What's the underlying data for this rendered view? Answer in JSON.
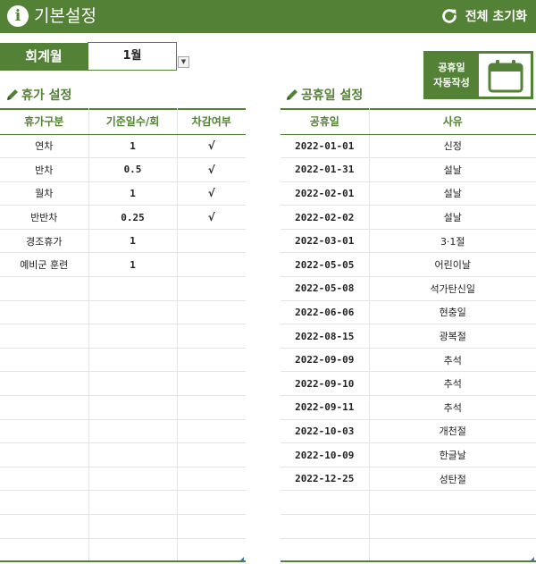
{
  "header": {
    "title": "기본설정",
    "reset_label": "전체 초기화",
    "info_icon": "info-icon",
    "reset_icon": "refresh-icon"
  },
  "fiscal": {
    "label": "회계월",
    "value": "1월"
  },
  "holiday_button": {
    "line1": "공휴일",
    "line2": "자동작성",
    "icon": "calendar-icon"
  },
  "leave_section": {
    "title": "휴가 설정",
    "columns": [
      "휴가구분",
      "기준일수/회",
      "차감여부"
    ],
    "rows": [
      {
        "type": "연차",
        "days": "1",
        "deduct": "√"
      },
      {
        "type": "반차",
        "days": "0.5",
        "deduct": "√"
      },
      {
        "type": "월차",
        "days": "1",
        "deduct": "√"
      },
      {
        "type": "반반차",
        "days": "0.25",
        "deduct": "√"
      },
      {
        "type": "경조휴가",
        "days": "1",
        "deduct": ""
      },
      {
        "type": "예비군 훈련",
        "days": "1",
        "deduct": ""
      },
      {
        "type": "",
        "days": "",
        "deduct": ""
      },
      {
        "type": "",
        "days": "",
        "deduct": ""
      },
      {
        "type": "",
        "days": "",
        "deduct": ""
      },
      {
        "type": "",
        "days": "",
        "deduct": ""
      },
      {
        "type": "",
        "days": "",
        "deduct": ""
      },
      {
        "type": "",
        "days": "",
        "deduct": ""
      },
      {
        "type": "",
        "days": "",
        "deduct": ""
      },
      {
        "type": "",
        "days": "",
        "deduct": ""
      },
      {
        "type": "",
        "days": "",
        "deduct": ""
      },
      {
        "type": "",
        "days": "",
        "deduct": ""
      },
      {
        "type": "",
        "days": "",
        "deduct": ""
      },
      {
        "type": "",
        "days": "",
        "deduct": ""
      }
    ]
  },
  "holiday_section": {
    "title": "공휴일 설정",
    "columns": [
      "공휴일",
      "사유"
    ],
    "rows": [
      {
        "date": "2022-01-01",
        "reason": "신정"
      },
      {
        "date": "2022-01-31",
        "reason": "설날"
      },
      {
        "date": "2022-02-01",
        "reason": "설날"
      },
      {
        "date": "2022-02-02",
        "reason": "설날"
      },
      {
        "date": "2022-03-01",
        "reason": "3·1절"
      },
      {
        "date": "2022-05-05",
        "reason": "어린이날"
      },
      {
        "date": "2022-05-08",
        "reason": "석가탄신일"
      },
      {
        "date": "2022-06-06",
        "reason": "현충일"
      },
      {
        "date": "2022-08-15",
        "reason": "광복절"
      },
      {
        "date": "2022-09-09",
        "reason": "추석"
      },
      {
        "date": "2022-09-10",
        "reason": "추석"
      },
      {
        "date": "2022-09-11",
        "reason": "추석"
      },
      {
        "date": "2022-10-03",
        "reason": "개천절"
      },
      {
        "date": "2022-10-09",
        "reason": "한글날"
      },
      {
        "date": "2022-12-25",
        "reason": "성탄절"
      },
      {
        "date": "",
        "reason": ""
      },
      {
        "date": "",
        "reason": ""
      },
      {
        "date": "",
        "reason": ""
      }
    ]
  },
  "colors": {
    "accent": "#538135",
    "grid": "#e3e3e3"
  }
}
